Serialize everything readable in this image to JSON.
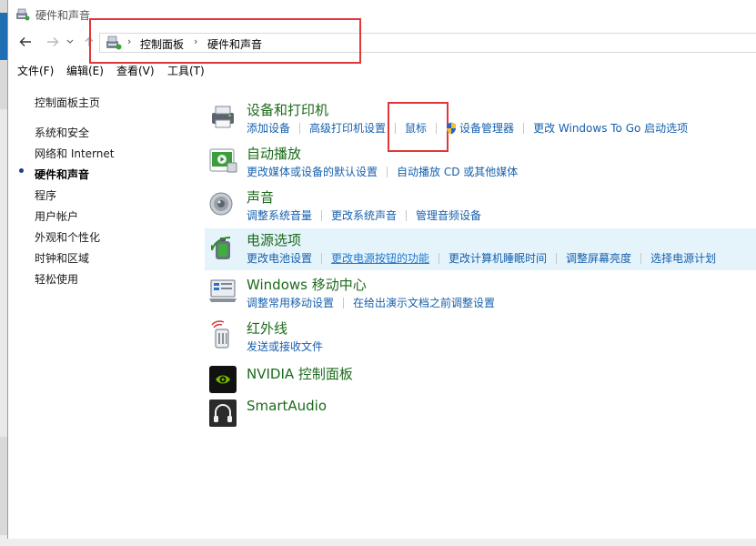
{
  "window": {
    "title": "硬件和声音"
  },
  "address": {
    "crumbs": [
      "控制面板",
      "硬件和声音"
    ]
  },
  "menu": [
    "文件(F)",
    "编辑(E)",
    "查看(V)",
    "工具(T)"
  ],
  "leftnav": {
    "home": "控制面板主页",
    "items": [
      "系统和安全",
      "网络和 Internet",
      "硬件和声音",
      "程序",
      "用户帐户",
      "外观和个性化",
      "时钟和区域",
      "轻松使用"
    ],
    "current_index": 2
  },
  "sections": [
    {
      "title": "设备和打印机",
      "icon": "printer-icon",
      "links": [
        "添加设备",
        "高级打印机设置",
        "鼠标",
        "设备管理器",
        "更改 Windows To Go 启动选项"
      ]
    },
    {
      "title": "自动播放",
      "icon": "autoplay-icon",
      "links": [
        "更改媒体或设备的默认设置",
        "自动播放 CD 或其他媒体"
      ]
    },
    {
      "title": "声音",
      "icon": "speaker-icon",
      "links": [
        "调整系统音量",
        "更改系统声音",
        "管理音频设备"
      ]
    },
    {
      "title": "电源选项",
      "icon": "power-icon",
      "links": [
        "更改电池设置",
        "更改电源按钮的功能",
        "更改计算机睡眠时间",
        "调整屏幕亮度",
        "选择电源计划"
      ]
    },
    {
      "title": "Windows 移动中心",
      "icon": "mobility-center-icon",
      "links": [
        "调整常用移动设置",
        "在给出演示文档之前调整设置"
      ]
    },
    {
      "title": "红外线",
      "icon": "infrared-icon",
      "links": [
        "发送或接收文件"
      ]
    },
    {
      "title": "NVIDIA 控制面板",
      "icon": "nvidia-icon",
      "links": []
    },
    {
      "title": "SmartAudio",
      "icon": "smartaudio-icon",
      "links": []
    }
  ],
  "colors": {
    "section_title": "#1c6a1c",
    "link": "#1660ad",
    "highlight_box": "#e0373b",
    "hover_row": "#e5f3fb"
  }
}
